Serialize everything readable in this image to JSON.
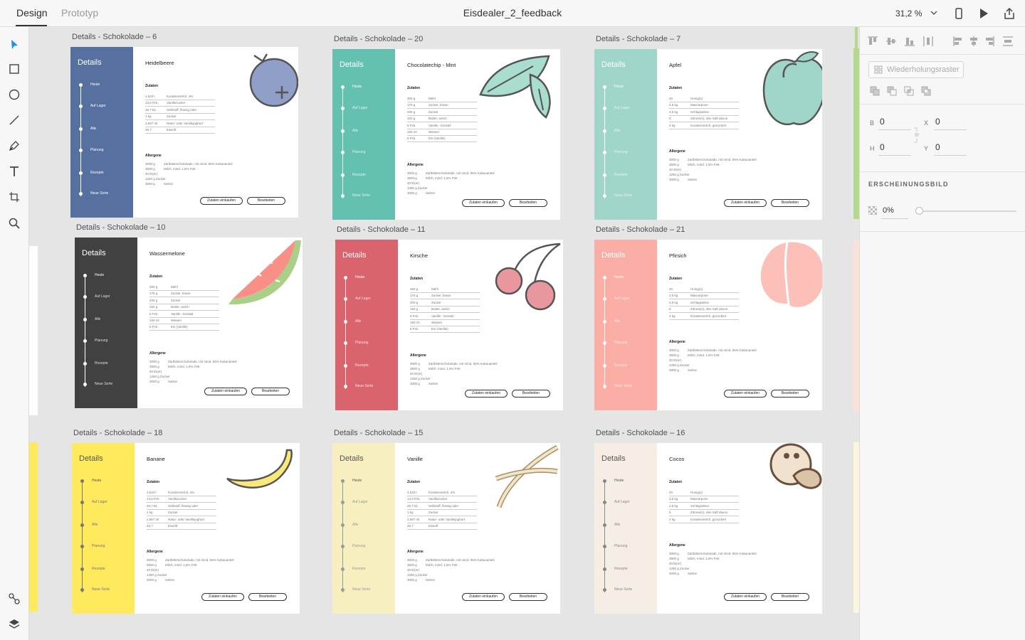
{
  "app": {
    "tabs": [
      {
        "label": "Design"
      },
      {
        "label": "Prototyp"
      }
    ],
    "document_title": "Eisdealer_2_feedback",
    "zoom": "31,2 %"
  },
  "right_panel": {
    "repeat_grid": "Wiederholungsraster",
    "fields": {
      "w_label": "B",
      "w_value": "0",
      "x_label": "X",
      "x_value": "0",
      "h_label": "H",
      "h_value": "0",
      "y_label": "Y",
      "y_value": "0"
    },
    "appearance_title": "ERSCHEINUNGSBILD",
    "opacity": "0%"
  },
  "colors": {
    "blue": "#56709f",
    "teal": "#64c1b0",
    "mint": "#a0d5ca",
    "dark": "#414141",
    "red": "#d9646e",
    "peach": "#faaea5",
    "yellow": "#ffe95c",
    "cream": "#f7efbf",
    "beige": "#f6eee4"
  },
  "artboards": [
    {
      "label": "Details - Schokolade – 6",
      "flavor": "Heidelbeere",
      "theme": "blue",
      "fruit": "blueberry-icon",
      "recipe": "A"
    },
    {
      "label": "Details - Schokolade – 20",
      "flavor": "Chocolatechip - Mint",
      "theme": "teal",
      "fruit": "leaf-icon",
      "recipe": "B"
    },
    {
      "label": "Details - Schokolade – 7",
      "flavor": "Apfel",
      "theme": "mint",
      "fruit": "apple-icon",
      "recipe": "C"
    },
    {
      "label": "Details - Schokolade – 10",
      "flavor": "Wassermelone",
      "theme": "dark",
      "fruit": "watermelon-icon",
      "recipe": "B"
    },
    {
      "label": "Details - Schokolade – 11",
      "flavor": "Kirsche",
      "theme": "red",
      "fruit": "cherry-icon",
      "recipe": "B"
    },
    {
      "label": "Details - Schokolade – 21",
      "flavor": "Pfirsich",
      "theme": "peach",
      "fruit": "peach-icon",
      "recipe": "C"
    },
    {
      "label": "Details - Schokolade – 18",
      "flavor": "Banane",
      "theme": "yellow",
      "fruit": "banana-icon",
      "recipe": "A"
    },
    {
      "label": "Details - Schokolade – 15",
      "flavor": "Vanille",
      "theme": "cream",
      "fruit": "vanilla-icon",
      "recipe": "A"
    },
    {
      "label": "Details - Schokolade – 16",
      "flavor": "Cocos",
      "theme": "beige",
      "fruit": "coconut-icon",
      "recipe": "C"
    }
  ],
  "sidebar": {
    "title": "Details",
    "nav": [
      "Heute",
      "Auf Lager",
      "Alle",
      "Planung",
      "Rezepte",
      "Neue Sorte"
    ]
  },
  "sections": {
    "ingredients": "Zutaten",
    "allergens": "Allergene"
  },
  "buttons": {
    "buy": "Zutaten einkaufen",
    "edit": "Bearbeiten"
  },
  "recipes": {
    "A": [
      [
        "4,533 l",
        "Kondensmilch, 4%"
      ],
      [
        "13,5 Pck.",
        "Vanillezucker"
      ],
      [
        "26,7 EL",
        "Süßstoff, flüssig oder"
      ],
      [
        "1 kg",
        "Zucker"
      ],
      [
        "2,667 ml",
        "Natur- oder Vanillejoghurt"
      ],
      [
        "26,7",
        "Eiweiß"
      ]
    ],
    "B": [
      [
        "300 g",
        "Mehl"
      ],
      [
        "175 g",
        "Zucker, braun"
      ],
      [
        "200 g",
        "Zucker"
      ],
      [
        "150 g",
        "Butter, weich"
      ],
      [
        "5 Pck.",
        "Vanille - Extrakt"
      ],
      [
        "150 ml",
        "Wasser"
      ],
      [
        "5 Pck.",
        "Eis (Vanille)"
      ]
    ],
    "C": [
      [
        "20",
        "Honig(s)"
      ],
      [
        "2,5 kg",
        "Mascarpone"
      ],
      [
        "2,5 kg",
        "Schlagsahne"
      ],
      [
        "5",
        "Zitrone(n), den Saft davon"
      ],
      [
        "4 kg",
        "Kondensmilch, gezuckert"
      ]
    ]
  },
  "allergens": [
    [
      "3000 g",
      "Zartbitterschokolade, mit mind. 55% Kakaoanteil"
    ],
    [
      "3500 g",
      "Milch, mind. 1,5% Fett"
    ],
    [
      "40 Ei(er)",
      ""
    ],
    [
      "1250 g Zucker",
      ""
    ],
    [
      "3000 g",
      "Sahne"
    ]
  ]
}
